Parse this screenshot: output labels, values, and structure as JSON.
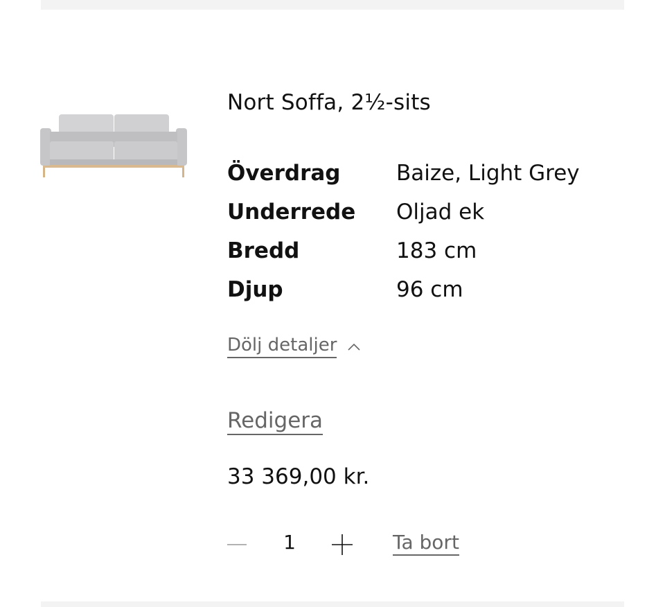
{
  "product": {
    "title": "Nort Soffa, 2½-sits",
    "image_icon": "sofa-image",
    "specs": [
      {
        "label": "Överdrag",
        "value": "Baize, Light Grey"
      },
      {
        "label": "Underrede",
        "value": "Oljad ek"
      },
      {
        "label": "Bredd",
        "value": "183 cm"
      },
      {
        "label": "Djup",
        "value": "96 cm"
      }
    ],
    "toggle_details_label": "Dölj detaljer",
    "edit_label": "Redigera",
    "price": "33 369,00 kr.",
    "quantity": "1",
    "remove_label": "Ta bort"
  },
  "colors": {
    "text": "#111111",
    "link": "#666666",
    "divider": "#f3f3f3",
    "fabric": "#c9c9cb",
    "wood": "#d6b48a"
  },
  "icons": {
    "toggle": "chevron-up-icon",
    "minus": "minus-icon",
    "plus": "plus-icon"
  }
}
